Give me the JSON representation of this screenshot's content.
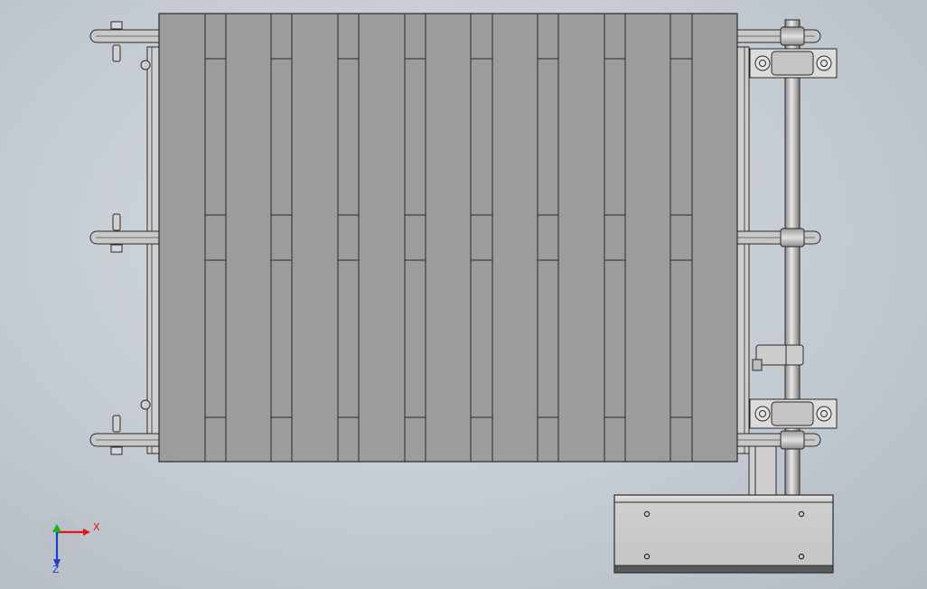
{
  "viewport": {
    "title": "",
    "background_top": "#d8dde3",
    "background_bottom": "#b4bac2"
  },
  "model": {
    "type": "chain-slat-conveyor-top-view",
    "slat_color": "#9c9c9c",
    "edge_color": "#2a2a2a",
    "metal_light": "#dcdcdc",
    "metal_mid": "#bdbdbd",
    "slat_columns": 17,
    "chain_strands": 3,
    "bearing_blocks": 2
  },
  "triad": {
    "x_label": "X",
    "z_label": "Z",
    "x_color": "#e01515",
    "y_color": "#18b418",
    "z_color": "#1c3ccc"
  }
}
